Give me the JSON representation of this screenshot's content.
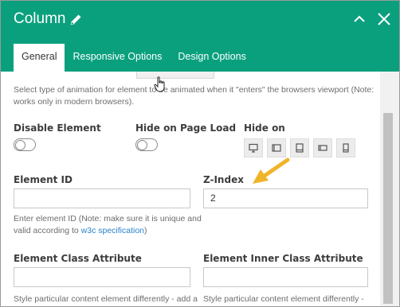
{
  "window": {
    "title": "Column",
    "title_icon": "pencil-icon",
    "actions": [
      "minimize-icon",
      "close-icon"
    ]
  },
  "tabs": [
    {
      "label": "General",
      "active": true
    },
    {
      "label": "Responsive Options",
      "active": false
    },
    {
      "label": "Design Options",
      "active": false
    }
  ],
  "animation": {
    "help_line1": "Select type of animation for element to be animated when it \"enters\" the browsers viewport (Note:",
    "help_line2": "works only in modern browsers)."
  },
  "disable_element": {
    "label": "Disable Element",
    "enabled": false
  },
  "hide_on_page_load": {
    "label": "Hide on Page Load",
    "enabled": false
  },
  "hide_on": {
    "label": "Hide on",
    "devices": [
      "desktop-icon",
      "tablet-landscape-icon",
      "tablet-portrait-icon",
      "mobile-landscape-icon",
      "mobile-portrait-icon"
    ]
  },
  "element_id": {
    "label": "Element ID",
    "value": "",
    "help_line1": "Enter element ID (Note: make sure it is unique and",
    "help_line2_prefix": "valid according to ",
    "help_link": "w3c specification",
    "help_line2_suffix": ")"
  },
  "z_index": {
    "label": "Z-Index",
    "value": "2"
  },
  "element_class": {
    "label": "Element Class Attribute",
    "value": "",
    "help_partial": "Style particular content element differently - add a"
  },
  "element_inner_class": {
    "label": "Element Inner Class Attribute",
    "value": "",
    "help_partial": "Style particular content element differently -"
  },
  "colors": {
    "header": "#0aa07e",
    "link": "#2b82c9",
    "arrow": "#f0b429"
  }
}
